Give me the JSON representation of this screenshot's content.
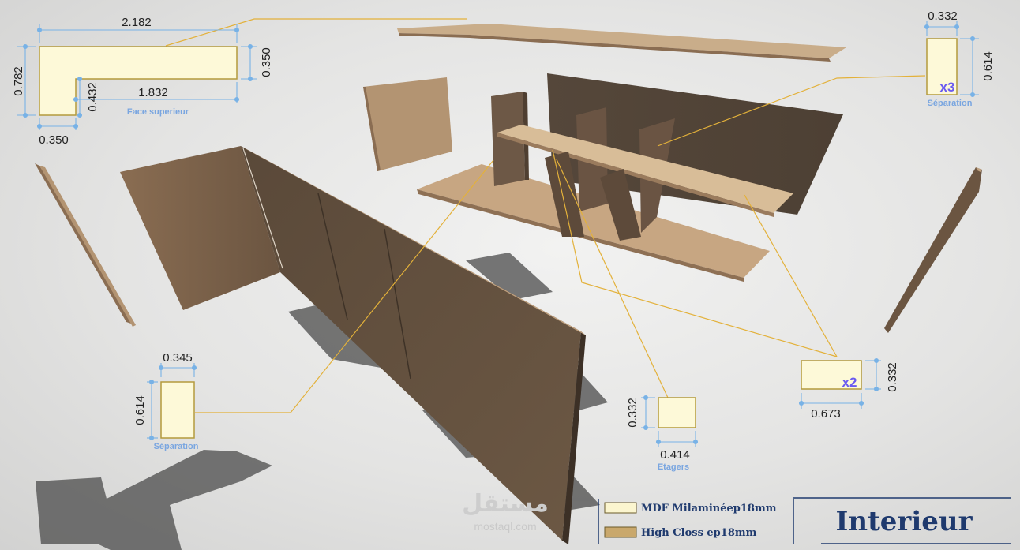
{
  "callouts": {
    "top_face": {
      "dims": [
        "2.182",
        "0.782",
        "0.350",
        "0.432",
        "1.832",
        "0.350"
      ],
      "caption": "Face superieur"
    },
    "separation_right": {
      "width": "0.332",
      "height": "0.614",
      "multiplier": "x3",
      "caption": "Séparation"
    },
    "separation_left": {
      "width": "0.345",
      "height": "0.614",
      "caption": "Séparation"
    },
    "etagers": {
      "height": "0.332",
      "width": "0.414",
      "caption": "Etagers"
    },
    "shelf_x2": {
      "height": "0.332",
      "width": "0.673",
      "multiplier": "x2"
    }
  },
  "legend": [
    {
      "label": "MDF Milaminéep18mm",
      "swatch": "#fbf5cf"
    },
    {
      "label": "High Closs ep18mm",
      "swatch": "#c9a86c"
    }
  ],
  "brand": "Interieur",
  "watermark": {
    "arabic": "مستقل",
    "latin": "mostaql.com"
  },
  "colors": {
    "panel_light": "#fdf9d8",
    "panel_border": "#b49a3c",
    "leader_line": "#e3b13a",
    "dim_line": "#78b2e6",
    "wood_dark": "#5c4b3b",
    "wood_light": "#c6a783",
    "brand_blue": "#1f3a6e"
  }
}
